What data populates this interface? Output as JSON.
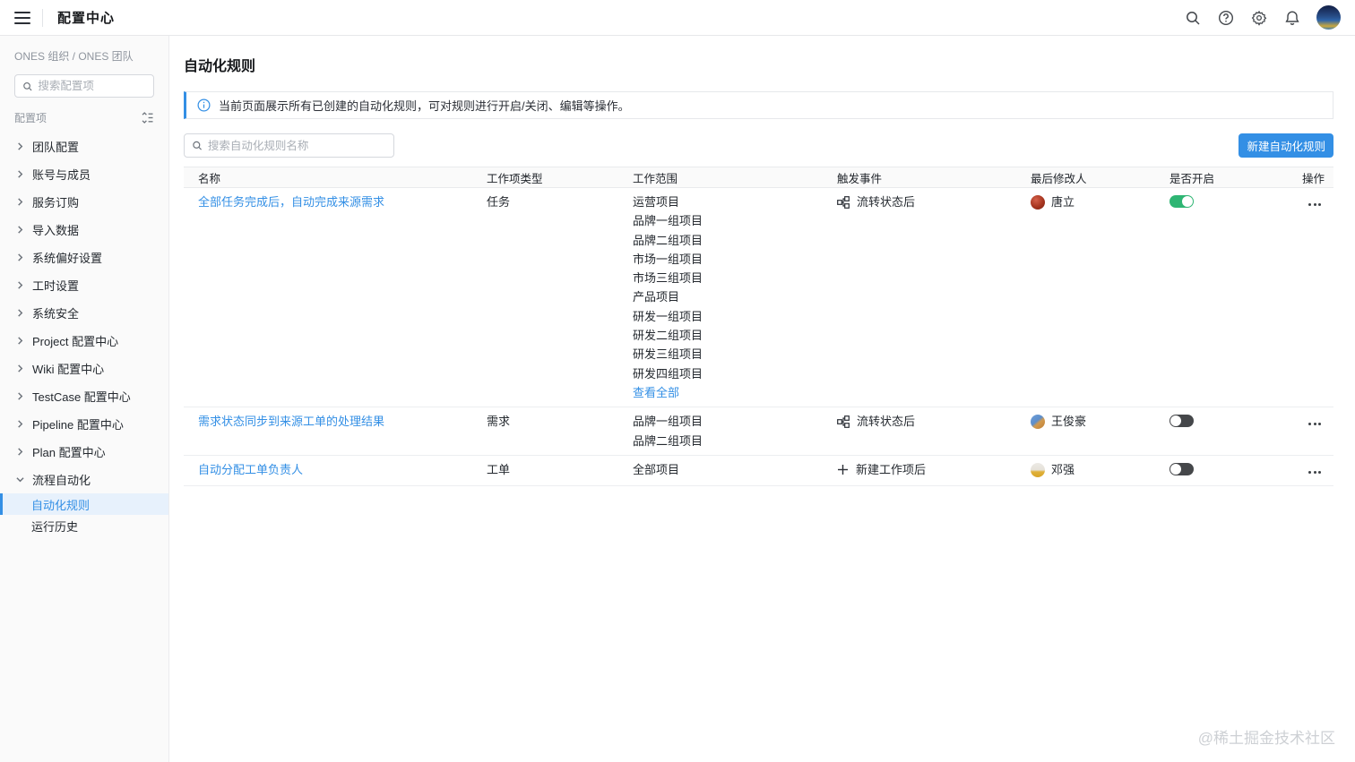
{
  "header": {
    "title": "配置中心",
    "icons": {
      "menu": "hamburger-icon",
      "search": "search-icon",
      "help": "help-icon",
      "settings": "gear-icon",
      "notifications": "bell-icon",
      "avatar": "user-avatar"
    }
  },
  "sidebar": {
    "breadcrumb": "ONES 组织 / ONES 团队",
    "search_placeholder": "搜索配置项",
    "section_label": "配置项",
    "items": [
      {
        "label": "团队配置"
      },
      {
        "label": "账号与成员"
      },
      {
        "label": "服务订购"
      },
      {
        "label": "导入数据"
      },
      {
        "label": "系统偏好设置"
      },
      {
        "label": "工时设置"
      },
      {
        "label": "系统安全"
      },
      {
        "label": "Project 配置中心"
      },
      {
        "label": "Wiki 配置中心"
      },
      {
        "label": "TestCase 配置中心"
      },
      {
        "label": "Pipeline 配置中心"
      },
      {
        "label": "Plan 配置中心"
      }
    ],
    "group": {
      "label": "流程自动化",
      "expanded": true,
      "children": [
        {
          "label": "自动化规则",
          "active": true
        },
        {
          "label": "运行历史",
          "active": false
        }
      ]
    }
  },
  "main": {
    "page_title": "自动化规则",
    "banner": {
      "text": "当前页面展示所有已创建的自动化规则，可对规则进行开启/关闭、编辑等操作。"
    },
    "search_placeholder": "搜索自动化规则名称",
    "create_button": "新建自动化规则",
    "table": {
      "columns": [
        "名称",
        "工作项类型",
        "工作范围",
        "触发事件",
        "最后修改人",
        "是否开启",
        "操作"
      ],
      "rows": [
        {
          "name": "全部任务完成后，自动完成来源需求",
          "type": "任务",
          "scopes": [
            "运营项目",
            "品牌一组项目",
            "品牌二组项目",
            "市场一组项目",
            "市场三组项目",
            "产品项目",
            "研发一组项目",
            "研发二组项目",
            "研发三组项目",
            "研发四组项目"
          ],
          "more_link": "查看全部",
          "trigger": {
            "icon": "workflow-icon",
            "label": "流转状态后"
          },
          "modifier": {
            "name": "唐立"
          },
          "enabled": true
        },
        {
          "name": "需求状态同步到来源工单的处理结果",
          "type": "需求",
          "scopes": [
            "品牌一组项目",
            "品牌二组项目"
          ],
          "trigger": {
            "icon": "workflow-icon",
            "label": "流转状态后"
          },
          "modifier": {
            "name": "王俊豪"
          },
          "enabled": false
        },
        {
          "name": "自动分配工单负责人",
          "type": "工单",
          "scopes": [
            "全部项目"
          ],
          "trigger": {
            "icon": "plus-icon",
            "label": "新建工作项后"
          },
          "modifier": {
            "name": "邓强"
          },
          "enabled": false
        }
      ]
    }
  },
  "watermark": "@稀土掘金技术社区",
  "colors": {
    "accent_blue": "#338fe5",
    "link_blue": "#338fe5",
    "toggle_on_green": "#2eb573",
    "toggle_off_gray": "#45474a",
    "sidebar_active_bg": "#e7f1fc",
    "banner_border_blue": "#338fe5",
    "avatar_tangli": "#a6351f",
    "avatar_wangjunhao": "#6f9fd8",
    "avatar_dengqiang": "#e0b13a"
  }
}
